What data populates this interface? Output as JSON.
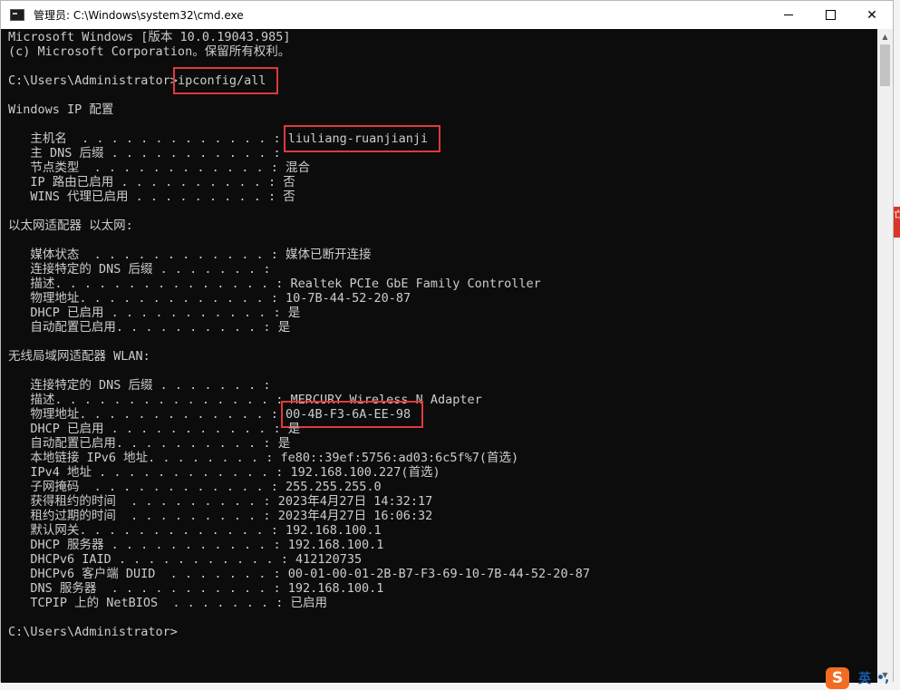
{
  "window": {
    "title": "管理员: C:\\Windows\\system32\\cmd.exe",
    "minimize_glyph": "—",
    "maximize_glyph": "☐",
    "close_glyph": "✕"
  },
  "console": {
    "lines": [
      "Microsoft Windows [版本 10.0.19043.985]",
      "(c) Microsoft Corporation。保留所有权利。",
      "",
      "C:\\Users\\Administrator>ipconfig/all",
      "",
      "Windows IP 配置",
      "",
      "   主机名  . . . . . . . . . . . . . : liuliang-ruanjianji",
      "   主 DNS 后缀 . . . . . . . . . . . :",
      "   节点类型  . . . . . . . . . . . . : 混合",
      "   IP 路由已启用 . . . . . . . . . . : 否",
      "   WINS 代理已启用 . . . . . . . . . : 否",
      "",
      "以太网适配器 以太网:",
      "",
      "   媒体状态  . . . . . . . . . . . . : 媒体已断开连接",
      "   连接特定的 DNS 后缀 . . . . . . . :",
      "   描述. . . . . . . . . . . . . . . : Realtek PCIe GbE Family Controller",
      "   物理地址. . . . . . . . . . . . . : 10-7B-44-52-20-87",
      "   DHCP 已启用 . . . . . . . . . . . : 是",
      "   自动配置已启用. . . . . . . . . . : 是",
      "",
      "无线局域网适配器 WLAN:",
      "",
      "   连接特定的 DNS 后缀 . . . . . . . :",
      "   描述. . . . . . . . . . . . . . . : MERCURY Wireless N Adapter",
      "   物理地址. . . . . . . . . . . . . : 00-4B-F3-6A-EE-98",
      "   DHCP 已启用 . . . . . . . . . . . : 是",
      "   自动配置已启用. . . . . . . . . . : 是",
      "   本地链接 IPv6 地址. . . . . . . . : fe80::39ef:5756:ad03:6c5f%7(首选)",
      "   IPv4 地址 . . . . . . . . . . . . : 192.168.100.227(首选)",
      "   子网掩码  . . . . . . . . . . . . : 255.255.255.0",
      "   获得租约的时间  . . . . . . . . . : 2023年4月27日 14:32:17",
      "   租约过期的时间  . . . . . . . . . : 2023年4月27日 16:06:32",
      "   默认网关. . . . . . . . . . . . . : 192.168.100.1",
      "   DHCP 服务器 . . . . . . . . . . . : 192.168.100.1",
      "   DHCPv6 IAID . . . . . . . . . . . : 412120735",
      "   DHCPv6 客户端 DUID  . . . . . . . : 00-01-00-01-2B-B7-F3-69-10-7B-44-52-20-87",
      "   DNS 服务器  . . . . . . . . . . . : 192.168.100.1",
      "   TCPIP 上的 NetBIOS  . . . . . . . : 已启用",
      "",
      "C:\\Users\\Administrator>"
    ],
    "highlights": [
      "ipconfig/all",
      "liuliang-ruanjianji",
      "00-4B-F3-6A-EE-98"
    ],
    "highlight_color": "#e0383c",
    "text_color": "#cccccc",
    "background_color": "#0c0c0c"
  },
  "scrollbar": {
    "up_glyph": "▲",
    "down_glyph": "▼"
  },
  "ime": {
    "logo": "S",
    "lang": "英",
    "punct": "•,"
  },
  "desktop": {
    "edge_text": "亡"
  }
}
